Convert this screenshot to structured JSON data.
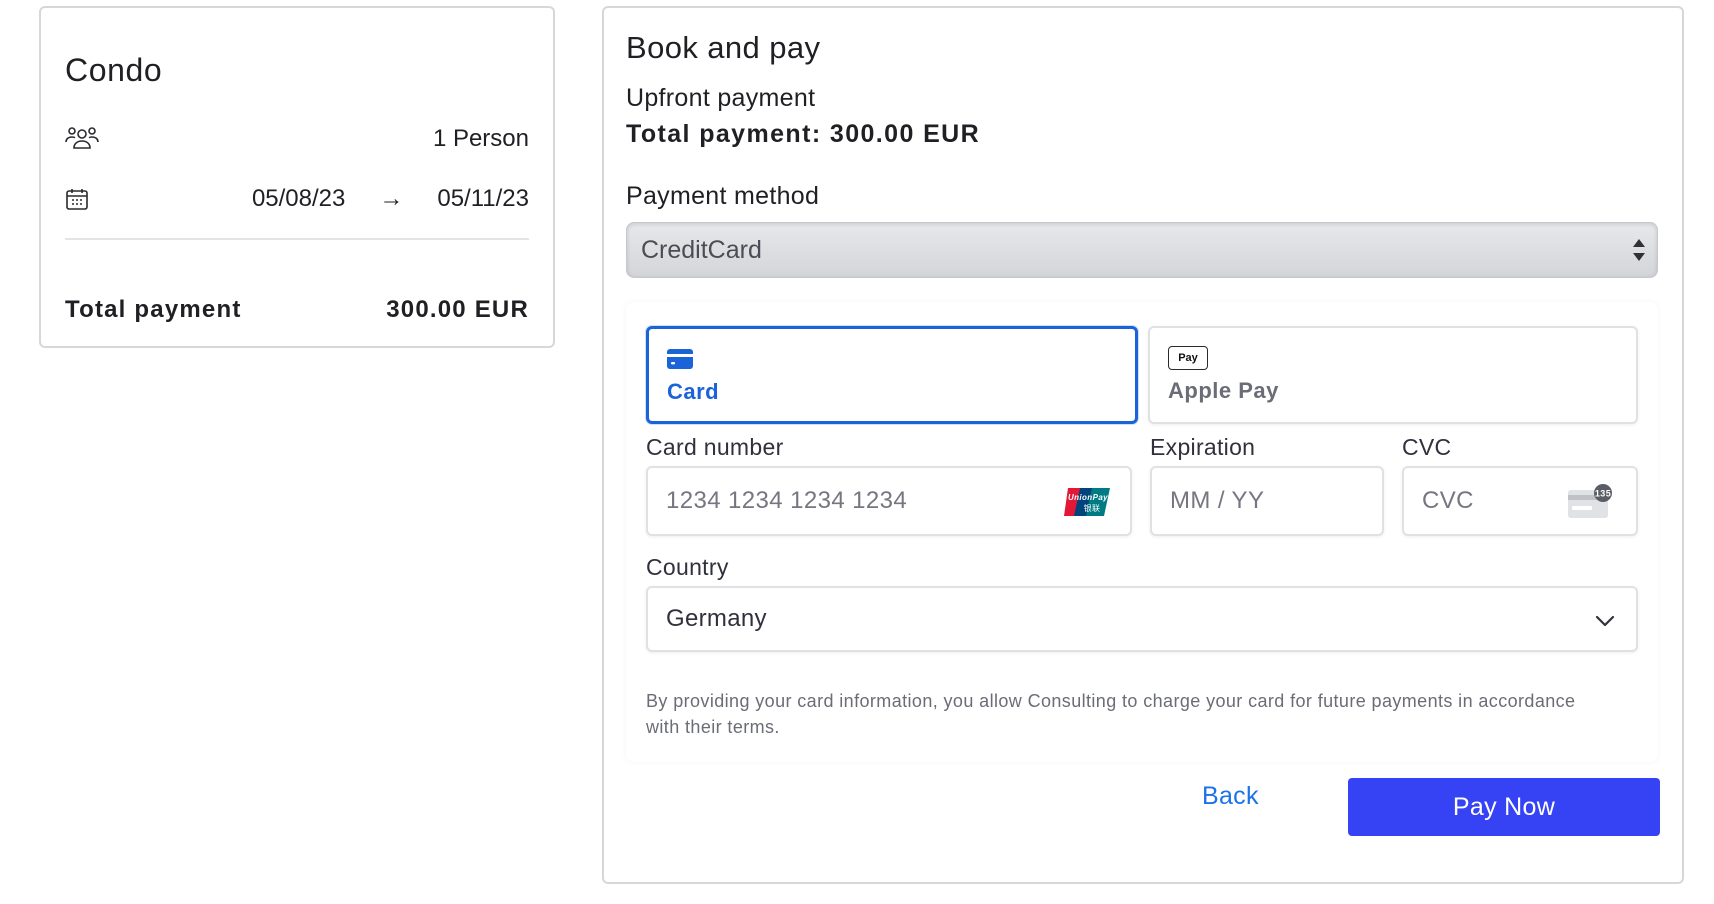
{
  "summary": {
    "title": "Condo",
    "persons": "1 Person",
    "date_from": "05/08/23",
    "date_to": "05/11/23",
    "arrow": "→",
    "total_label": "Total payment",
    "total_value": "300.00 EUR",
    "icons": {
      "persons": "people-icon",
      "dates": "calendar-icon"
    }
  },
  "booking": {
    "title": "Book and pay",
    "upfront": "Upfront payment",
    "total": "Total payment: 300.00 EUR",
    "payment_method_label": "Payment method",
    "payment_method_value": "CreditCard"
  },
  "payment_element": {
    "tabs": [
      {
        "label": "Card",
        "icon": "credit-card-icon",
        "selected": true
      },
      {
        "label": "Apple Pay",
        "icon": "apple-pay-icon",
        "selected": false,
        "icon_text": "Pay"
      }
    ],
    "card_number_label": "Card number",
    "card_number_placeholder": "1234 1234 1234 1234",
    "card_brand_icon": "unionpay-icon",
    "expiration_label": "Expiration",
    "expiration_placeholder": "MM / YY",
    "cvc_label": "CVC",
    "cvc_placeholder": "CVC",
    "cvc_icon": "cvc-card-icon",
    "cvc_icon_text": "135",
    "country_label": "Country",
    "country_value": "Germany",
    "legal": "By providing your card information, you allow Consulting to charge your card for future payments in accordance with their terms."
  },
  "actions": {
    "back": "Back",
    "pay": "Pay Now"
  },
  "colors": {
    "accent_blue": "#1a63d8",
    "pay_button": "#3543f5",
    "link": "#1a73e8"
  }
}
